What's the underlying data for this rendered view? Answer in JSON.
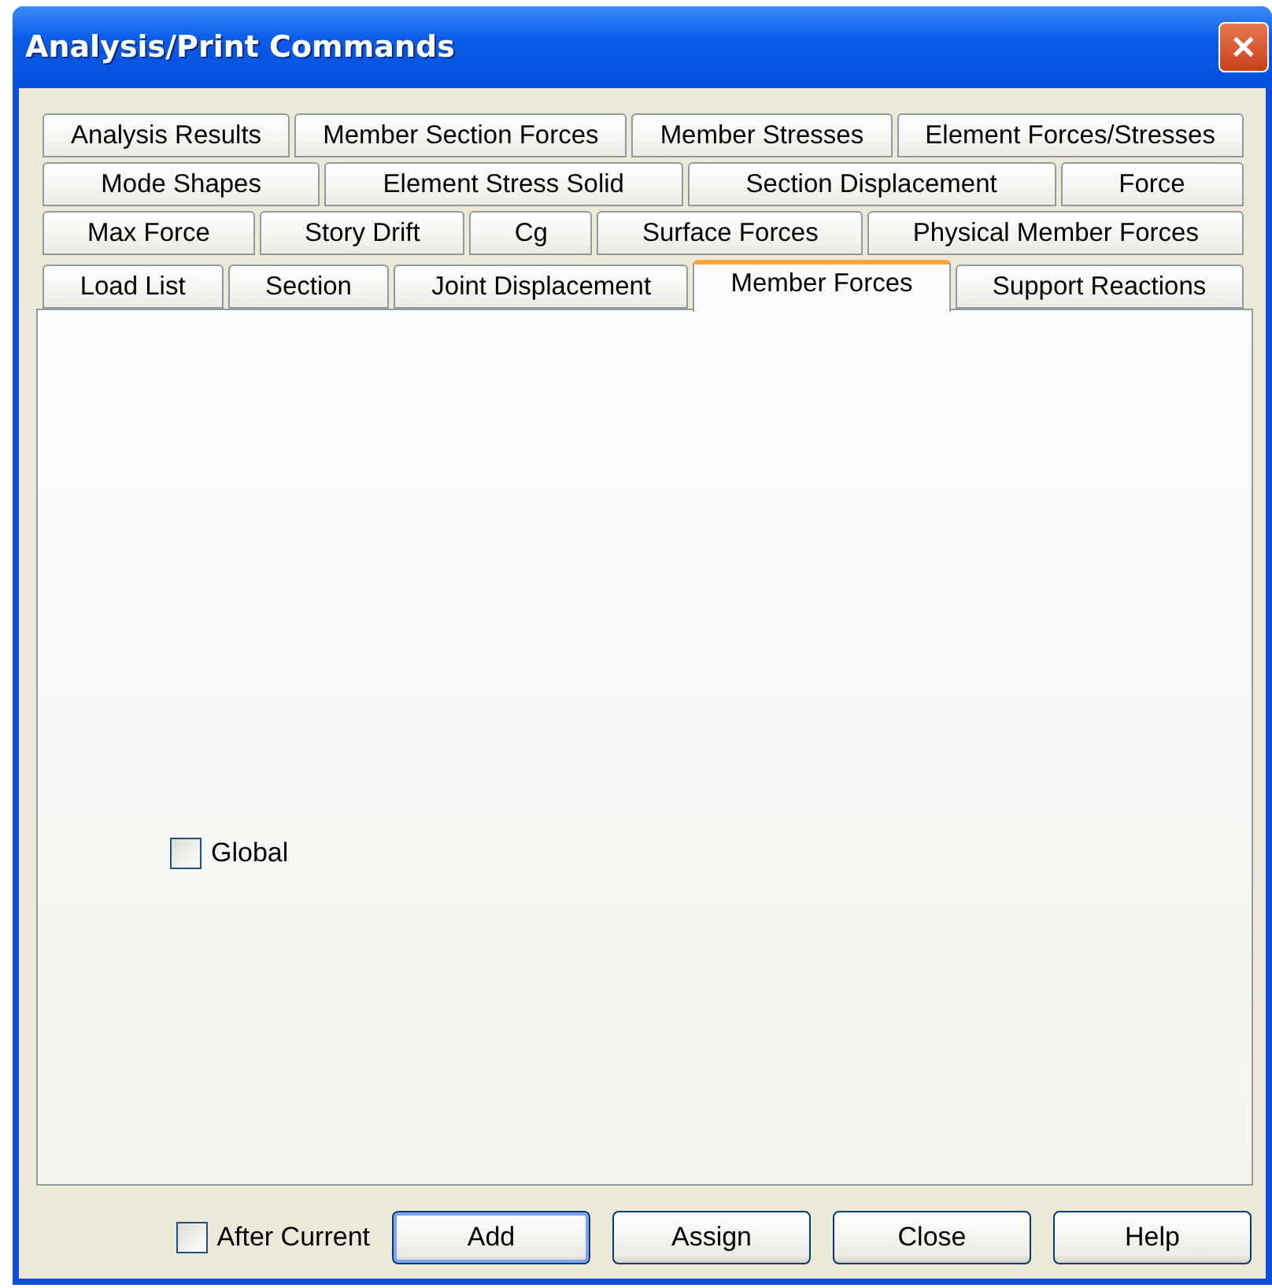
{
  "window": {
    "title": "Analysis/Print Commands",
    "close": "✕"
  },
  "tab_rows": [
    {
      "tabs": [
        {
          "label": "Analysis Results",
          "selected": false
        },
        {
          "label": "Member Section Forces",
          "selected": false
        },
        {
          "label": "Member Stresses",
          "selected": false
        },
        {
          "label": "Element Forces/Stresses",
          "selected": false
        }
      ]
    },
    {
      "tabs": [
        {
          "label": "Mode Shapes",
          "selected": false
        },
        {
          "label": "Element Stress Solid",
          "selected": false
        },
        {
          "label": "Section Displacement",
          "selected": false
        },
        {
          "label": "Force",
          "selected": false
        }
      ]
    },
    {
      "tabs": [
        {
          "label": "Max Force",
          "selected": false
        },
        {
          "label": "Story Drift",
          "selected": false
        },
        {
          "label": "Cg",
          "selected": false
        },
        {
          "label": "Surface Forces",
          "selected": false
        },
        {
          "label": "Physical Member Forces",
          "selected": false
        }
      ]
    },
    {
      "tabs": [
        {
          "label": "Load List",
          "selected": false
        },
        {
          "label": "Section",
          "selected": false
        },
        {
          "label": "Joint Displacement",
          "selected": false
        },
        {
          "label": "Member Forces",
          "selected": true
        },
        {
          "label": "Support Reactions",
          "selected": false
        }
      ]
    }
  ],
  "panel": {
    "options": [
      {
        "label": "Global",
        "checked": false
      }
    ]
  },
  "footer": {
    "after_current": {
      "label": "After Current",
      "checked": false
    },
    "buttons": [
      {
        "label": "Add",
        "default": true
      },
      {
        "label": "Assign",
        "default": false
      },
      {
        "label": "Close",
        "default": false
      },
      {
        "label": "Help",
        "default": false
      }
    ]
  }
}
